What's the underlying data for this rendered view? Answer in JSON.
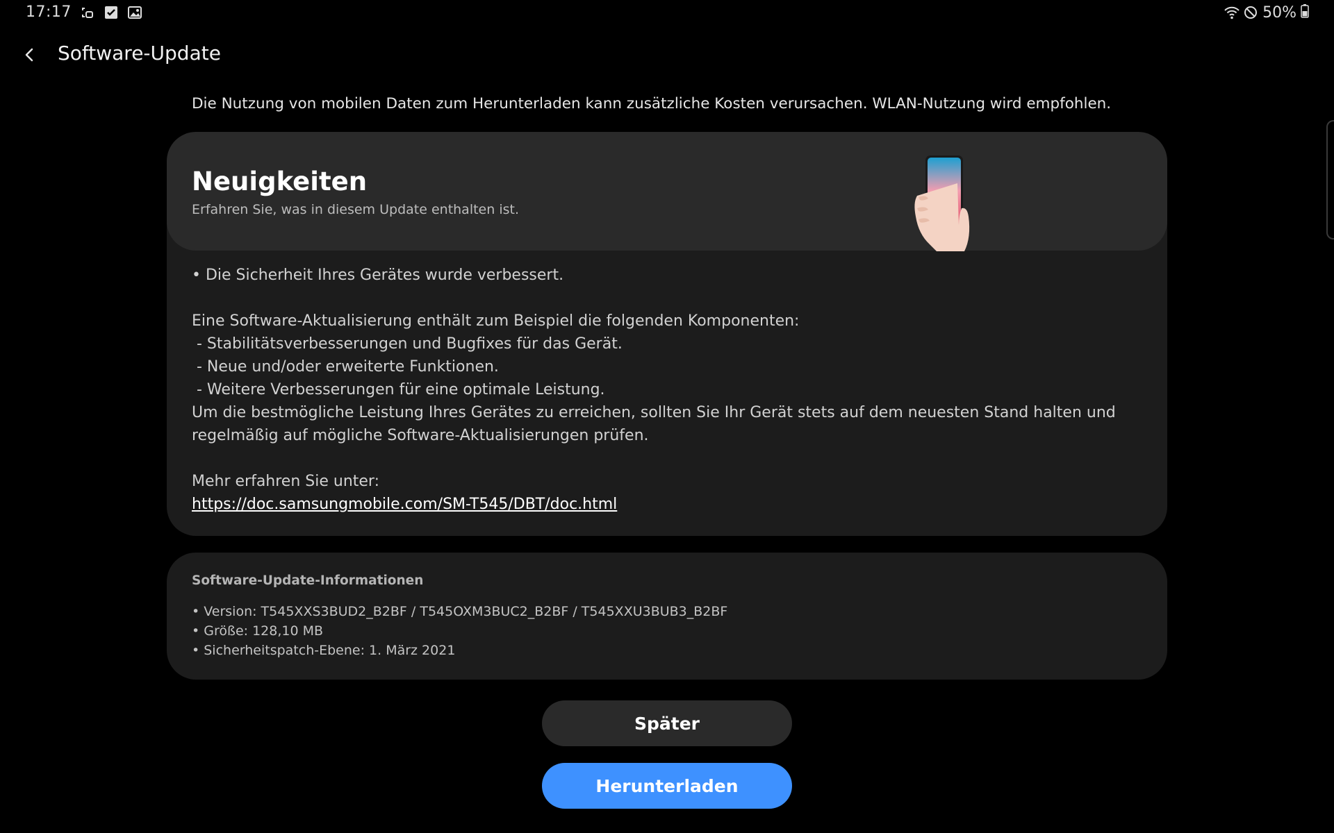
{
  "status_bar": {
    "time": "17:17",
    "battery": "50%",
    "icons_left": [
      "screenshot-icon",
      "checkbox-icon",
      "image-icon"
    ],
    "icons_right": [
      "wifi-icon",
      "do-not-disturb-icon",
      "battery-icon"
    ]
  },
  "app_bar": {
    "title": "Software-Update"
  },
  "notice": "Die Nutzung von mobilen Daten zum Herunterladen kann zusätzliche Kosten verursachen. WLAN-Nutzung wird empfohlen.",
  "news": {
    "title": "Neuigkeiten",
    "subtitle": "Erfahren Sie, was in diesem Update enthalten ist.",
    "security_line": "• Die Sicherheit Ihres Gerätes wurde verbessert.",
    "components_intro": "Eine Software-Aktualisierung enthält zum Beispiel die folgenden Komponenten:",
    "components": [
      " - Stabilitätsverbesserungen und Bugfixes für das Gerät.",
      " - Neue und/oder erweiterte Funktionen.",
      " - Weitere Verbesserungen für eine optimale Leistung."
    ],
    "recommendation": "Um die bestmögliche Leistung Ihres Gerätes zu erreichen, sollten Sie Ihr Gerät stets auf dem neuesten Stand halten und regelmäßig auf mögliche Software-Aktualisierungen prüfen.",
    "more_info": "Mehr erfahren Sie unter:",
    "link": "https://doc.samsungmobile.com/SM-T545/DBT/doc.html"
  },
  "info": {
    "title": "Software-Update-Informationen",
    "version": "• Version: T545XXS3BUD2_B2BF / T545OXM3BUC2_B2BF / T545XXU3BUB3_B2BF",
    "size": "• Größe: 128,10 MB",
    "patch": "• Sicherheitspatch-Ebene: 1. März 2021"
  },
  "buttons": {
    "later": "Später",
    "download": "Herunterladen"
  },
  "colors": {
    "accent": "#3e91ff",
    "card": "#1c1c1c",
    "card_header": "#2a2a2a"
  }
}
